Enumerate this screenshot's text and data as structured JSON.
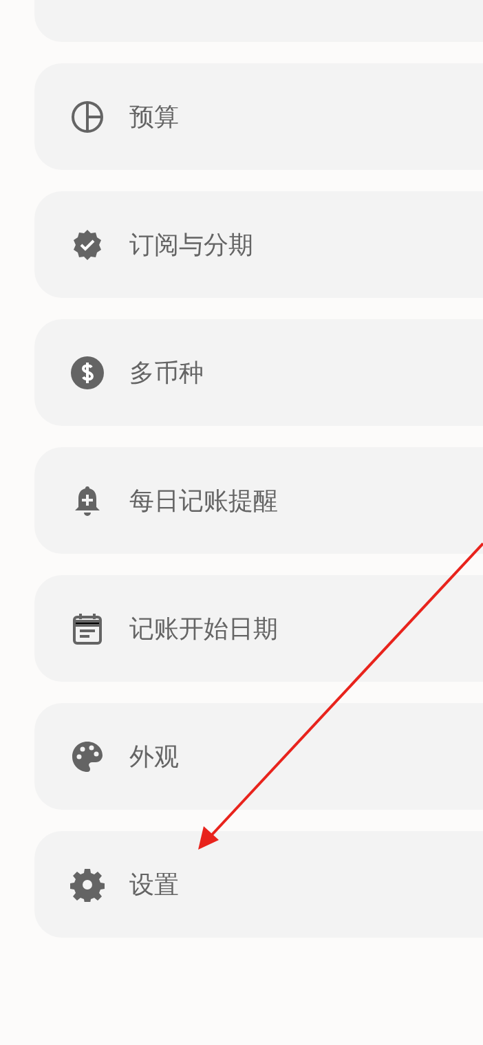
{
  "menu_items": [
    {
      "label": "预算"
    },
    {
      "label": "订阅与分期"
    },
    {
      "label": "多币种"
    },
    {
      "label": "每日记账提醒"
    },
    {
      "label": "记账开始日期"
    },
    {
      "label": "外观"
    },
    {
      "label": "设置"
    }
  ],
  "annotation": {
    "kind": "arrow"
  }
}
